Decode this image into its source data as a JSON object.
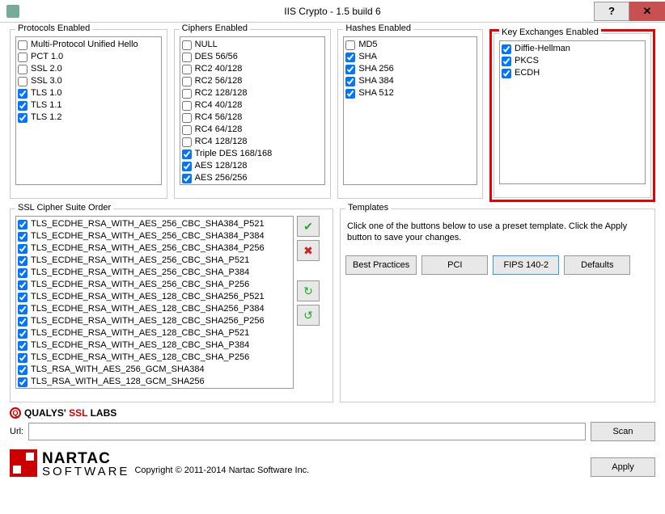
{
  "window": {
    "title": "IIS Crypto - 1.5 build 6"
  },
  "groups": {
    "protocols_label": "Protocols Enabled",
    "ciphers_label": "Ciphers Enabled",
    "hashes_label": "Hashes Enabled",
    "kex_label": "Key Exchanges Enabled",
    "suite_label": "SSL Cipher Suite Order",
    "templates_label": "Templates"
  },
  "protocols": [
    {
      "label": "Multi-Protocol Unified Hello",
      "checked": false
    },
    {
      "label": "PCT 1.0",
      "checked": false
    },
    {
      "label": "SSL 2.0",
      "checked": false
    },
    {
      "label": "SSL 3.0",
      "checked": false
    },
    {
      "label": "TLS 1.0",
      "checked": true
    },
    {
      "label": "TLS 1.1",
      "checked": true
    },
    {
      "label": "TLS 1.2",
      "checked": true
    }
  ],
  "ciphers": [
    {
      "label": "NULL",
      "checked": false
    },
    {
      "label": "DES 56/56",
      "checked": false
    },
    {
      "label": "RC2 40/128",
      "checked": false
    },
    {
      "label": "RC2 56/128",
      "checked": false
    },
    {
      "label": "RC2 128/128",
      "checked": false
    },
    {
      "label": "RC4 40/128",
      "checked": false
    },
    {
      "label": "RC4 56/128",
      "checked": false
    },
    {
      "label": "RC4 64/128",
      "checked": false
    },
    {
      "label": "RC4 128/128",
      "checked": false
    },
    {
      "label": "Triple DES 168/168",
      "checked": true
    },
    {
      "label": "AES 128/128",
      "checked": true
    },
    {
      "label": "AES 256/256",
      "checked": true
    }
  ],
  "hashes": [
    {
      "label": "MD5",
      "checked": false
    },
    {
      "label": "SHA",
      "checked": true
    },
    {
      "label": "SHA 256",
      "checked": true
    },
    {
      "label": "SHA 384",
      "checked": true
    },
    {
      "label": "SHA 512",
      "checked": true
    }
  ],
  "kex": [
    {
      "label": "Diffie-Hellman",
      "checked": true
    },
    {
      "label": "PKCS",
      "checked": true
    },
    {
      "label": "ECDH",
      "checked": true
    }
  ],
  "suites": [
    {
      "label": "TLS_ECDHE_RSA_WITH_AES_256_CBC_SHA384_P521",
      "checked": true
    },
    {
      "label": "TLS_ECDHE_RSA_WITH_AES_256_CBC_SHA384_P384",
      "checked": true
    },
    {
      "label": "TLS_ECDHE_RSA_WITH_AES_256_CBC_SHA384_P256",
      "checked": true
    },
    {
      "label": "TLS_ECDHE_RSA_WITH_AES_256_CBC_SHA_P521",
      "checked": true
    },
    {
      "label": "TLS_ECDHE_RSA_WITH_AES_256_CBC_SHA_P384",
      "checked": true
    },
    {
      "label": "TLS_ECDHE_RSA_WITH_AES_256_CBC_SHA_P256",
      "checked": true
    },
    {
      "label": "TLS_ECDHE_RSA_WITH_AES_128_CBC_SHA256_P521",
      "checked": true
    },
    {
      "label": "TLS_ECDHE_RSA_WITH_AES_128_CBC_SHA256_P384",
      "checked": true
    },
    {
      "label": "TLS_ECDHE_RSA_WITH_AES_128_CBC_SHA256_P256",
      "checked": true
    },
    {
      "label": "TLS_ECDHE_RSA_WITH_AES_128_CBC_SHA_P521",
      "checked": true
    },
    {
      "label": "TLS_ECDHE_RSA_WITH_AES_128_CBC_SHA_P384",
      "checked": true
    },
    {
      "label": "TLS_ECDHE_RSA_WITH_AES_128_CBC_SHA_P256",
      "checked": true
    },
    {
      "label": "TLS_RSA_WITH_AES_256_GCM_SHA384",
      "checked": true
    },
    {
      "label": "TLS_RSA_WITH_AES_128_GCM_SHA256",
      "checked": true
    }
  ],
  "templates": {
    "help_text": "Click one of the buttons below to use a preset template. Click the Apply button to save your changes.",
    "best_practices": "Best Practices",
    "pci": "PCI",
    "fips": "FIPS 140-2",
    "defaults": "Defaults"
  },
  "qualys": {
    "brand1": "QUALYS'",
    "brand2": " SSL",
    "brand3": " LABS"
  },
  "url_label": "Url:",
  "scan_label": "Scan",
  "nartac": {
    "top": "NARTAC",
    "bottom": "SOFTWARE"
  },
  "copyright": "Copyright © 2011-2014 Nartac Software Inc.",
  "apply_label": "Apply"
}
